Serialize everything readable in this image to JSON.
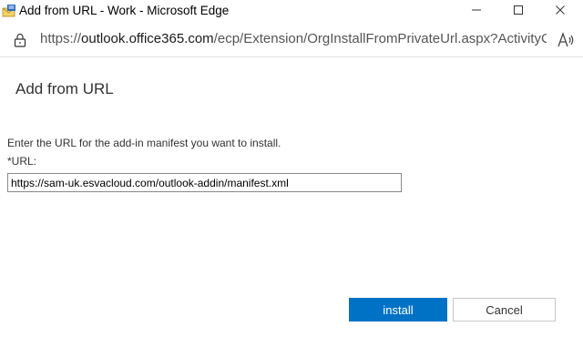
{
  "window": {
    "title": "Add from URL - Work - Microsoft Edge"
  },
  "address_bar": {
    "url_prefix": "https://",
    "url_host": "outlook.office365.com",
    "url_path": "/ecp/Extension/OrgInstallFromPrivateUrl.aspx?ActivityC..."
  },
  "dialog": {
    "title": "Add from URL",
    "instructions": "Enter the URL for the add-in manifest you want to install.",
    "url_label": "*URL:",
    "url_value": "https://sam-uk.esvacloud.com/outlook-addin/manifest.xml",
    "install_label": "install",
    "cancel_label": "Cancel"
  },
  "icons": {
    "app": "outlook-envelope-icon",
    "minimize": "minimize-icon",
    "maximize": "maximize-icon",
    "close": "close-icon",
    "lock": "lock-icon",
    "read_aloud": "read-aloud-icon"
  },
  "colors": {
    "primary_button": "#0072c6",
    "text": "#333333"
  }
}
